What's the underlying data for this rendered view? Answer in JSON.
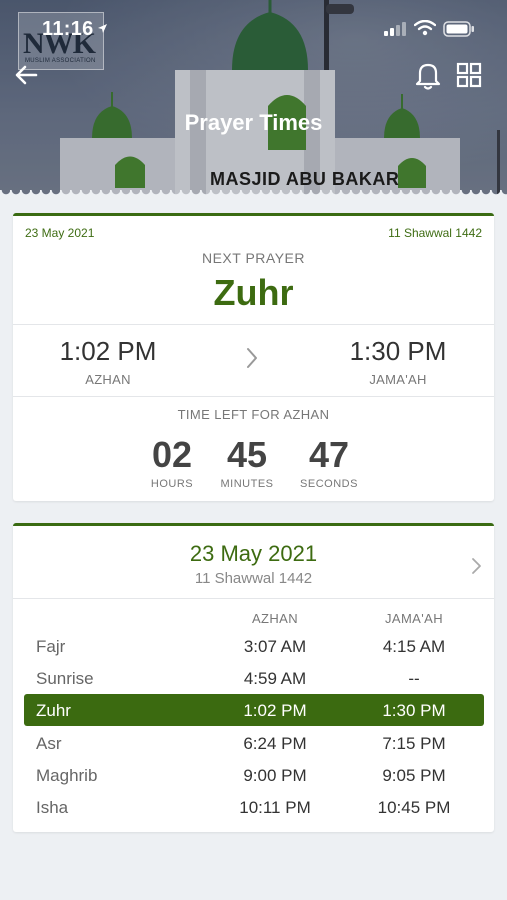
{
  "status_bar": {
    "time": "11:16"
  },
  "header": {
    "title": "Prayer Times",
    "logo_text": "NWK",
    "logo_sub": "MUSLIM ASSOCIATION",
    "mosque_sign": "MASJID ABU BAKAR"
  },
  "next_prayer_card": {
    "gregorian_date": "23 May 2021",
    "hijri_date": "11 Shawwal 1442",
    "next_label": "NEXT PRAYER",
    "next_name": "Zuhr",
    "azhan_time": "1:02 PM",
    "azhan_label": "AZHAN",
    "jamaah_time": "1:30 PM",
    "jamaah_label": "JAMA'AH",
    "time_left_label": "TIME LEFT FOR AZHAN",
    "countdown": {
      "hours": "02",
      "hours_label": "HOURS",
      "minutes": "45",
      "minutes_label": "MINUTES",
      "seconds": "47",
      "seconds_label": "SECONDS"
    }
  },
  "schedule_card": {
    "gregorian_date": "23 May 2021",
    "hijri_date": "11 Shawwal 1442",
    "col_azhan": "AZHAN",
    "col_jamaah": "JAMA'AH",
    "rows": [
      {
        "name": "Fajr",
        "azhan": "3:07 AM",
        "jamaah": "4:15 AM"
      },
      {
        "name": "Sunrise",
        "azhan": "4:59 AM",
        "jamaah": "--"
      },
      {
        "name": "Zuhr",
        "azhan": "1:02 PM",
        "jamaah": "1:30 PM"
      },
      {
        "name": "Asr",
        "azhan": "6:24 PM",
        "jamaah": "7:15 PM"
      },
      {
        "name": "Maghrib",
        "azhan": "9:00 PM",
        "jamaah": "9:05 PM"
      },
      {
        "name": "Isha",
        "azhan": "10:11 PM",
        "jamaah": "10:45 PM"
      }
    ],
    "active_row": "Zuhr"
  },
  "colors": {
    "accent": "#3b6a10",
    "accent_text": "#3d6b11",
    "background": "#edf0f3"
  },
  "icons": [
    "back-arrow-icon",
    "bell-icon",
    "grid-icon",
    "chevron-right-icon",
    "location-arrow-icon",
    "signal-icon",
    "wifi-icon",
    "battery-icon"
  ]
}
